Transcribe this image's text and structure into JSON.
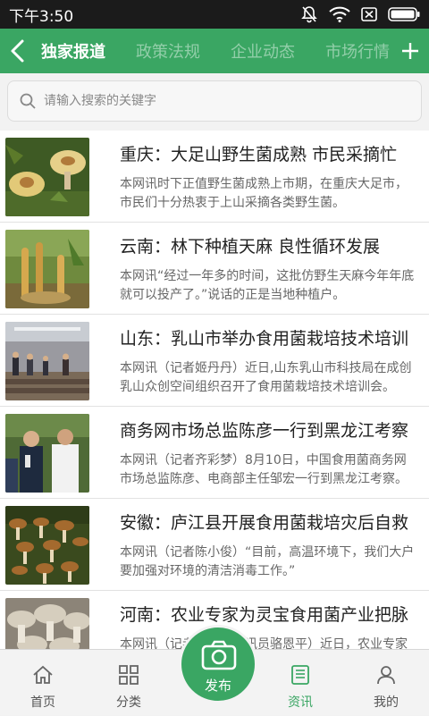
{
  "status_bar": {
    "time": "下午3:50"
  },
  "header": {
    "tabs": [
      {
        "label": "独家报道",
        "active": true
      },
      {
        "label": "政策法规",
        "active": false
      },
      {
        "label": "企业动态",
        "active": false
      },
      {
        "label": "市场行情",
        "active": false
      }
    ]
  },
  "search": {
    "placeholder": "请输入搜索的关键字"
  },
  "articles": [
    {
      "title": "重庆：大足山野生菌成熟 市民采摘忙",
      "desc": "本网讯时下正值野生菌成熟上市期，在重庆大足市，市民们十分热衷于上山采摘各类野生菌。"
    },
    {
      "title": "云南：林下种植天麻 良性循环发展",
      "desc": "本网讯“经过一年多的时间，这批仿野生天麻今年年底就可以投产了。”说话的正是当地种植户。"
    },
    {
      "title": "山东：乳山市举办食用菌栽培技术培训",
      "desc": "本网讯（记者姬丹丹）近日,山东乳山市科技局在成创乳山众创空间组织召开了食用菌栽培技术培训会。"
    },
    {
      "title": "商务网市场总监陈彦一行到黑龙江考察",
      "desc": "本网讯（记者齐彩梦）8月10日，中国食用菌商务网市场总监陈彦、电商部主任邹宏一行到黑龙江考察。"
    },
    {
      "title": "安徽：庐江县开展食用菌栽培灾后自救",
      "desc": "本网讯（记者陈小俊）“目前，高温环境下，我们大户要加强对环境的清洁消毒工作。”"
    },
    {
      "title": "河南：农业专家为灵宝食用菌产业把脉",
      "desc": "本网讯（记者明旭影通讯员骆恩平）近日，农业专家来到灵宝市为食用菌产业发展出谋划策。"
    }
  ],
  "bottom_nav": {
    "home": "首页",
    "category": "分类",
    "publish": "发布",
    "news": "资讯",
    "mine": "我的"
  },
  "colors": {
    "brand_green": "#3aa663",
    "status_bar": "#1b1b1b"
  }
}
